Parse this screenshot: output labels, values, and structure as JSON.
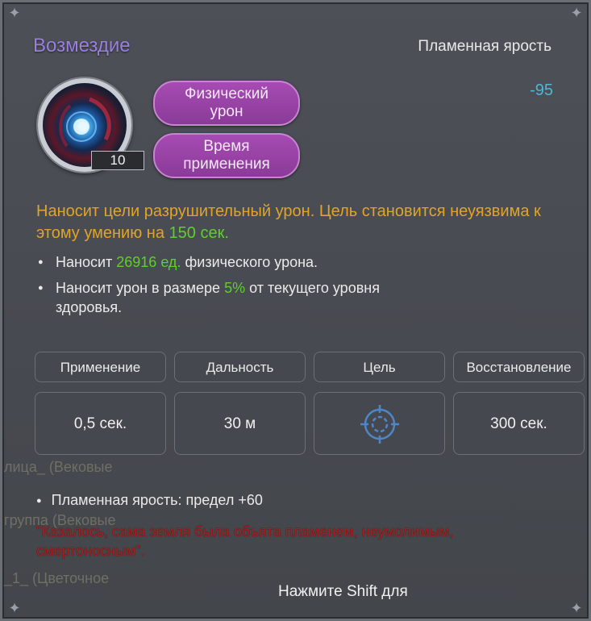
{
  "tooltip": {
    "title": "Возмездие",
    "skill_type": "Пламенная ярость",
    "cost": "-95",
    "icon": {
      "name": "retribution-skill-icon",
      "level": "10"
    },
    "tags": [
      "Физический\nурон",
      "Время\nприменения"
    ],
    "description": {
      "line": "Наносит цели разрушительный урон. Цель становится неуязвима к этому умению на ",
      "highlight": "150 сек.",
      "tail": ""
    },
    "effects": [
      {
        "pre": "Наносит ",
        "hl": "26916 ед.",
        "post": " физического урона."
      },
      {
        "pre": "Наносит урон в размере ",
        "hl": "5%",
        "post": " от текущего уровня здоровья."
      }
    ],
    "stats": [
      {
        "label": "Применение",
        "value": "0,5 сек."
      },
      {
        "label": "Дальность",
        "value": "30 м"
      },
      {
        "label": "Цель",
        "value": "",
        "icon": "target-crosshair-icon"
      },
      {
        "label": "Восстановление",
        "value": "300 сек."
      }
    ],
    "background_text": [
      "лица_ (Вековые",
      "группа (Вековые",
      "_1_ (Цветочное"
    ],
    "fury_limit": "Пламенная ярость: предел +60",
    "quote": "\"Казалось, сама земля была объята пламенем, неумолимым, смертоносным\".",
    "hint": "Нажмите Shift для"
  },
  "colors": {
    "title": "#9a7fe0",
    "cost": "#4fb6d6",
    "description": "#e0a42a",
    "highlight_green": "#5fce2f",
    "tag_pill": "#9a45a8",
    "quote_red": "#a81f1f"
  }
}
